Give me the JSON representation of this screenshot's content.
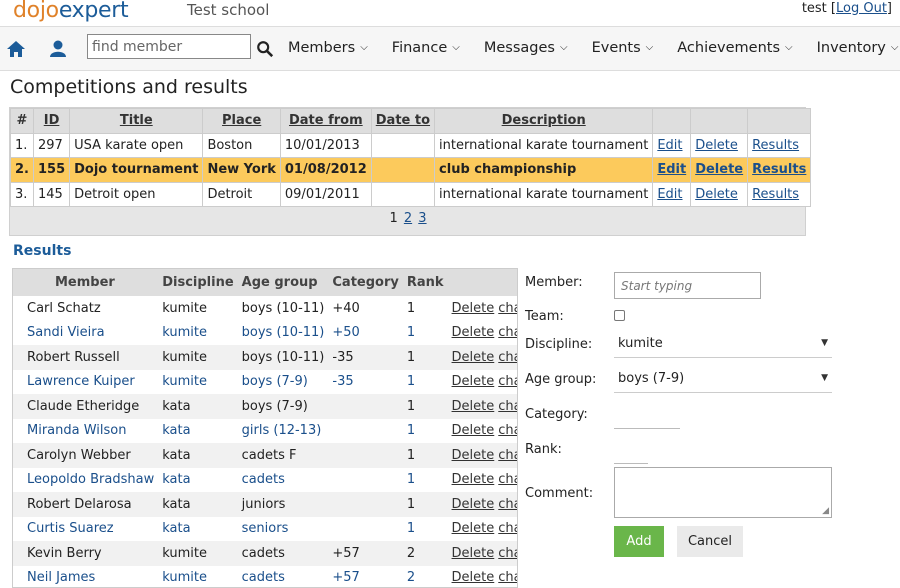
{
  "header": {
    "logo_part1": "dojo",
    "logo_part2": "expert",
    "school": "Test school",
    "username": "test",
    "logout_label": "Log Out"
  },
  "nav": {
    "home_icon": "home-icon",
    "user_icon": "user-icon",
    "search_icon": "search-icon",
    "search_placeholder": "find member",
    "menus": [
      "Members",
      "Finance",
      "Messages",
      "Events",
      "Achievements",
      "Inventory"
    ]
  },
  "page_title": "Competitions and results",
  "competitions": {
    "headers": [
      "#",
      "ID",
      "Title",
      "Place",
      "Date from",
      "Date to",
      "Description"
    ],
    "rows": [
      {
        "num": "1.",
        "id": "297",
        "title": "USA karate open",
        "place": "Boston",
        "date_from": "10/01/2013",
        "date_to": "",
        "description": "international karate tournament",
        "edit": "Edit",
        "delete": "Delete",
        "results": "Results"
      },
      {
        "num": "2.",
        "id": "155",
        "title": "Dojo tournament",
        "place": "New York",
        "date_from": "01/08/2012",
        "date_to": "",
        "description": "club championship",
        "edit": "Edit",
        "delete": "Delete",
        "results": "Results"
      },
      {
        "num": "3.",
        "id": "145",
        "title": "Detroit open",
        "place": "Detroit",
        "date_from": "09/01/2011",
        "date_to": "",
        "description": "international karate tournament",
        "edit": "Edit",
        "delete": "Delete",
        "results": "Results"
      }
    ],
    "selected_row": 1,
    "pages": [
      "1",
      "2",
      "3"
    ],
    "current_page": "1"
  },
  "results": {
    "heading": "Results",
    "headers": [
      "Member",
      "Discipline",
      "Age group",
      "Category",
      "Rank"
    ],
    "rows": [
      {
        "member": "Carl Schatz",
        "discipline": "kumite",
        "age_group": "boys (10-11)",
        "category": "+40",
        "rank": "1",
        "delete": "Delete",
        "change": "change"
      },
      {
        "member": "Sandi Vieira",
        "discipline": "kumite",
        "age_group": "boys (10-11)",
        "category": "+50",
        "rank": "1",
        "delete": "Delete",
        "change": "change"
      },
      {
        "member": "Robert Russell",
        "discipline": "kumite",
        "age_group": "boys (10-11)",
        "category": "-35",
        "rank": "1",
        "delete": "Delete",
        "change": "change"
      },
      {
        "member": "Lawrence Kuiper",
        "discipline": "kumite",
        "age_group": "boys (7-9)",
        "category": "-35",
        "rank": "1",
        "delete": "Delete",
        "change": "change"
      },
      {
        "member": "Claude Etheridge",
        "discipline": "kata",
        "age_group": "boys (7-9)",
        "category": "",
        "rank": "1",
        "delete": "Delete",
        "change": "change"
      },
      {
        "member": "Miranda Wilson",
        "discipline": "kata",
        "age_group": "girls (12-13)",
        "category": "",
        "rank": "1",
        "delete": "Delete",
        "change": "change"
      },
      {
        "member": "Carolyn Webber",
        "discipline": "kata",
        "age_group": "cadets F",
        "category": "",
        "rank": "1",
        "delete": "Delete",
        "change": "change"
      },
      {
        "member": "Leopoldo Bradshaw",
        "discipline": "kata",
        "age_group": "cadets",
        "category": "",
        "rank": "1",
        "delete": "Delete",
        "change": "change"
      },
      {
        "member": "Robert Delarosa",
        "discipline": "kata",
        "age_group": "juniors",
        "category": "",
        "rank": "1",
        "delete": "Delete",
        "change": "change"
      },
      {
        "member": "Curtis Suarez",
        "discipline": "kata",
        "age_group": "seniors",
        "category": "",
        "rank": "1",
        "delete": "Delete",
        "change": "change"
      },
      {
        "member": "Kevin Berry",
        "discipline": "kumite",
        "age_group": "cadets",
        "category": "+57",
        "rank": "2",
        "delete": "Delete",
        "change": "change"
      },
      {
        "member": "Neil James",
        "discipline": "kumite",
        "age_group": "cadets",
        "category": "+57",
        "rank": "2",
        "delete": "Delete",
        "change": "change"
      }
    ],
    "row_styles": [
      "rr",
      "rb",
      "ra",
      "rb",
      "ra",
      "rb",
      "ra",
      "rb",
      "ra",
      "rb",
      "ra",
      "rb"
    ]
  },
  "form": {
    "member_label": "Member:",
    "member_placeholder": "Start typing",
    "team_label": "Team:",
    "discipline_label": "Discipline:",
    "discipline_value": "kumite",
    "age_group_label": "Age group:",
    "age_group_value": "boys (7-9)",
    "category_label": "Category:",
    "rank_label": "Rank:",
    "comment_label": "Comment:",
    "add_label": "Add",
    "cancel_label": "Cancel"
  },
  "colors": {
    "accent_blue": "#1c5c99",
    "logo_orange": "#e0822a",
    "selected_row": "#fcca5c",
    "add_button": "#6ab64a"
  }
}
